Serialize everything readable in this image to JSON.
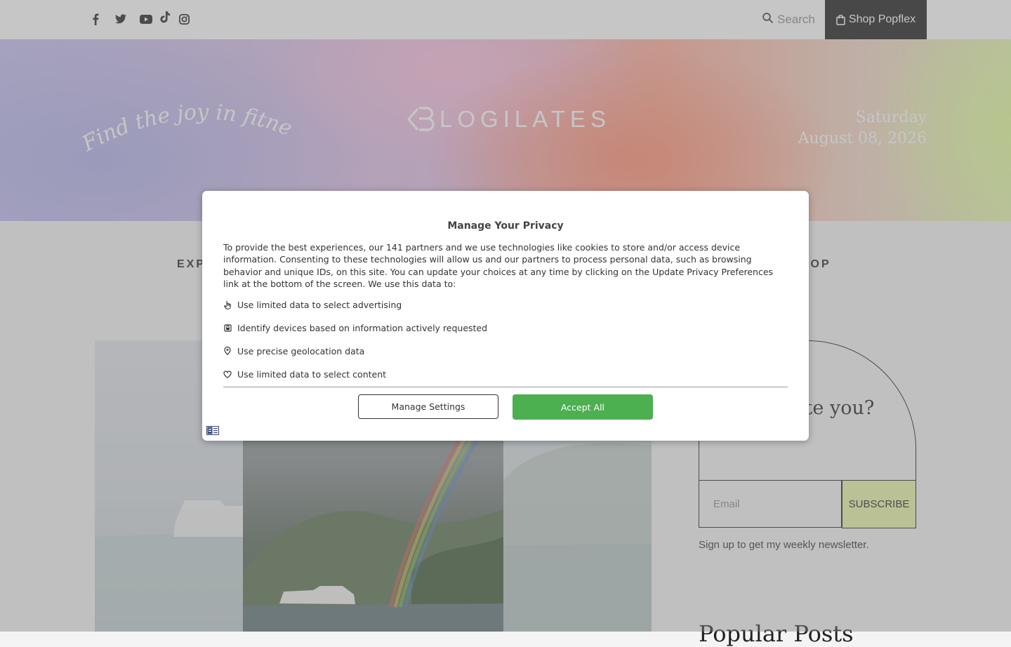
{
  "topbar": {
    "social_icons": [
      "facebook-icon",
      "twitter-icon",
      "youtube-icon",
      "tiktok-icon",
      "instagram-icon"
    ],
    "search_label": "Search",
    "shop_label": "Shop Popflex"
  },
  "hero": {
    "tagline": "Find the joy in fitness",
    "logo_text": "LOGILATES",
    "weekday": "Saturday",
    "date": "August 08, 2026"
  },
  "nav": {
    "left_partial": "EXP",
    "right_partial": "HOP"
  },
  "newsletter": {
    "question_partial": "rite you?",
    "email_placeholder": "Email",
    "subscribe_label": "SUBSCRIBE",
    "caption": "Sign up to get my weekly newsletter."
  },
  "popular": {
    "title_partial": "Popular Posts"
  },
  "privacy": {
    "title": "Manage Your Privacy",
    "body": "To provide the best experiences, our 141 partners and we use technologies like cookies to store and/or access device information. Consenting to these technologies will allow us and our partners to process personal data, such as browsing behavior and unique IDs, on this site. You can update your choices at any time by clicking on the Update Privacy Preferences link at the bottom of the screen. We use this data to:",
    "purposes": [
      {
        "icon": "hand-pointer-icon",
        "label": "Use limited data to select advertising"
      },
      {
        "icon": "device-icon",
        "label": "Identify devices based on information actively requested"
      },
      {
        "icon": "location-pin-icon",
        "label": "Use precise geolocation data"
      },
      {
        "icon": "heart-icon",
        "label": "Use limited data to select content"
      }
    ],
    "manage_label": "Manage Settings",
    "accept_label": "Accept All",
    "language_icon": "language-icon"
  },
  "colors": {
    "accept_green": "#4caf50",
    "shop_bg": "#1a1a1a",
    "subscribe_bg": "#eaf7a6"
  }
}
